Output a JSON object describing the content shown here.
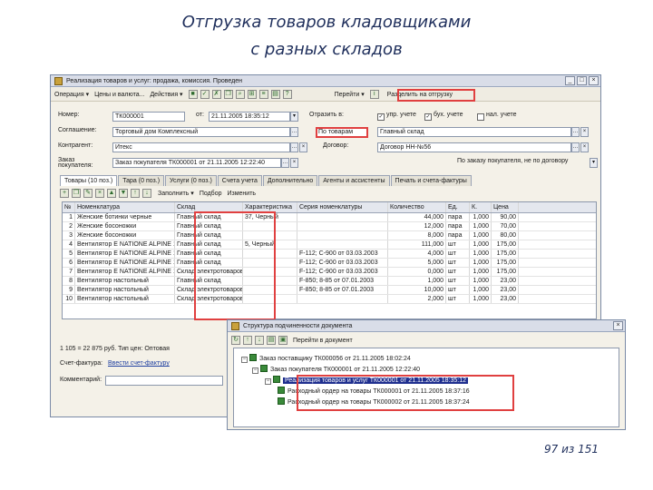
{
  "slide": {
    "title_line1": "Отгрузка товаров кладовщиками",
    "title_line2": "с разных складов",
    "page_number": "97 из 151"
  },
  "main_window": {
    "title": "Реализация товаров и услуг: продажа, комиссия. Проведен",
    "toolbar": {
      "operation": "Операция ▾",
      "prices": "Цены и валюта...",
      "actions": "Действия ▾",
      "go": "Перейти ▾",
      "split_button": "Разделить на отгрузку"
    },
    "form": {
      "number_label": "Номер:",
      "number_value": "ТК000001",
      "date_label": "от:",
      "date_value": "21.11.2005 18:35:12",
      "reflect_label": "Отразить в:",
      "reflect_upr": "упр. учете",
      "reflect_buh": "бух. учете",
      "reflect_nal": "нал. учете",
      "agreement_label": "Соглашение:",
      "agreement_value": "Торговый дом Комплексный",
      "warehouse_btn": "По товарам",
      "warehouse_value": "Главный склад",
      "contragent_label": "Контрагент:",
      "contragent_value": "Итекс",
      "contract_label": "Договор:",
      "contract_value": "Договор НН-№56",
      "order_label": "Заказ покупателя:",
      "order_value": "Заказ покупателя ТК000001 от 21.11.2005 12:22:40",
      "order_hint": "По заказу покупателя, не по договору"
    },
    "tabs": [
      "Товары (10 поз.)",
      "Тара (0 поз.)",
      "Услуги (0 поз.)",
      "Счета учета",
      "Дополнительно",
      "Агенты и ассистенты",
      "Печать и счета-фактуры"
    ],
    "grid_toolbar": {
      "fill": "Заполнить ▾",
      "pick": "Подбор",
      "change": "Изменить"
    },
    "grid": {
      "columns": [
        "№",
        "Номенклатура",
        "Склад",
        "Характеристика",
        "Серия номенклатуры",
        "Количество",
        "Ед.",
        "К.",
        "Цена"
      ],
      "rows": [
        [
          "1",
          "Женские ботинки черные",
          "Главный склад",
          "37, Черный",
          "",
          "44,000",
          "пара",
          "1,000",
          "90,00"
        ],
        [
          "2",
          "Женские босоножки",
          "Главный склад",
          "",
          "",
          "12,000",
          "пара",
          "1,000",
          "70,00"
        ],
        [
          "3",
          "Женские босоножки",
          "Главный склад",
          "",
          "",
          "8,000",
          "пара",
          "1,000",
          "80,00"
        ],
        [
          "4",
          "Вентилятор E NATIONE ALPINE 16",
          "Главный склад",
          "5, Черный",
          "",
          "111,000",
          "шт",
          "1,000",
          "175,00"
        ],
        [
          "5",
          "Вентилятор E NATIONE ALPINE 16",
          "Главный склад",
          "",
          "F-112; C-900 от 03.03.2003",
          "4,000",
          "шт",
          "1,000",
          "175,00"
        ],
        [
          "6",
          "Вентилятор E NATIONE ALPINE 16",
          "Главный склад",
          "",
          "F-112; C-900 от 03.03.2003",
          "5,000",
          "шт",
          "1,000",
          "175,00"
        ],
        [
          "7",
          "Вентилятор E NATIONE ALPINE 16",
          "Склад электротоваров",
          "",
          "F-112; C-900 от 03.03.2003",
          "0,000",
          "шт",
          "1,000",
          "175,00"
        ],
        [
          "8",
          "Вентилятор настольный",
          "Главный склад",
          "",
          "F-850; 8-85 от 07.01.2003",
          "1,000",
          "шт",
          "1,000",
          "23,00"
        ],
        [
          "9",
          "Вентилятор настольный",
          "Склад электротоваров",
          "",
          "F-850; 8-85 от 07.01.2003",
          "10,000",
          "шт",
          "1,000",
          "23,00"
        ],
        [
          "10",
          "Вентилятор настольный",
          "Склад электротоваров",
          "",
          "",
          "2,000",
          "шт",
          "1,000",
          "23,00"
        ]
      ]
    },
    "totals": "1 105 = 22 875 руб. Тип цен: Оптовая",
    "invoice_label": "Счет-фактура:",
    "invoice_value": "Ввести счет-фактуру",
    "comment_label": "Комментарий:"
  },
  "structure_window": {
    "title": "Структура подчиненности документа",
    "toolbar_btn": "Перейти в документ",
    "nodes": [
      {
        "text": "Заказ поставщику ТК000056 от 21.11.2005 18:02:24",
        "sel": false
      },
      {
        "text": "Заказ покупателя ТК000001 от 21.11.2005 12:22:40",
        "sel": false
      },
      {
        "text": "Реализация товаров и услуг ТК000001 от 21.11.2005 18:35:12",
        "sel": true
      },
      {
        "text": "Расходный ордер на товары ТК000001 от 21.11.2005 18:37:16",
        "sel": false
      },
      {
        "text": "Расходный ордер на товары ТК000002 от 21.11.2005 18:37:24",
        "sel": false
      }
    ]
  },
  "colors": {
    "title_text": "#1f2f5c",
    "highlight": "#e04040",
    "selection": "#1f2f8f"
  }
}
